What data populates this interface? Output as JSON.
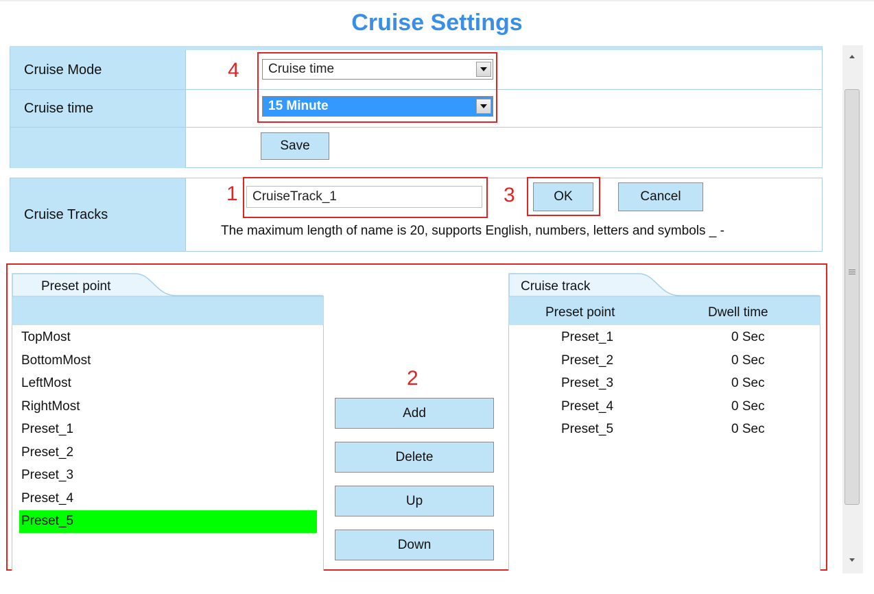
{
  "page_title": "Cruise Settings",
  "mode_section": {
    "cruise_mode_label": "Cruise Mode",
    "cruise_mode_value": "Cruise time",
    "cruise_time_label": "Cruise time",
    "cruise_time_value": "15 Minute",
    "save_label": "Save"
  },
  "tracks_section": {
    "label": "Cruise Tracks",
    "track_name_value": "CruiseTrack_1",
    "ok_label": "OK",
    "cancel_label": "Cancel",
    "hint": "The maximum length of name is 20, supports English, numbers, letters and symbols _ -"
  },
  "annotations": {
    "n1": "1",
    "n2": "2",
    "n3": "3",
    "n4": "4"
  },
  "preset_panel": {
    "tab_label": "Preset point",
    "items": [
      "TopMost",
      "BottomMost",
      "LeftMost",
      "RightMost",
      "Preset_1",
      "Preset_2",
      "Preset_3",
      "Preset_4",
      "Preset_5"
    ],
    "selected_item": "Preset_5",
    "selected_color": "#00ff00"
  },
  "actions": {
    "add": "Add",
    "delete": "Delete",
    "up": "Up",
    "down": "Down"
  },
  "cruise_track_panel": {
    "tab_label": "Cruise track",
    "col_preset": "Preset point",
    "col_dwell": "Dwell time",
    "rows": [
      {
        "preset": "Preset_1",
        "dwell": "0 Sec"
      },
      {
        "preset": "Preset_2",
        "dwell": "0 Sec"
      },
      {
        "preset": "Preset_3",
        "dwell": "0 Sec"
      },
      {
        "preset": "Preset_4",
        "dwell": "0 Sec"
      },
      {
        "preset": "Preset_5",
        "dwell": "0 Sec"
      }
    ]
  },
  "colors": {
    "title": "#3a8ee6",
    "label_bg": "#bfe4f7",
    "annotation": "#e02424"
  },
  "icons": {
    "scroll_up": "triangle-up-icon",
    "scroll_down": "triangle-down-icon",
    "scroll_grip": "grip-icon",
    "dropdown": "triangle-down-icon"
  }
}
